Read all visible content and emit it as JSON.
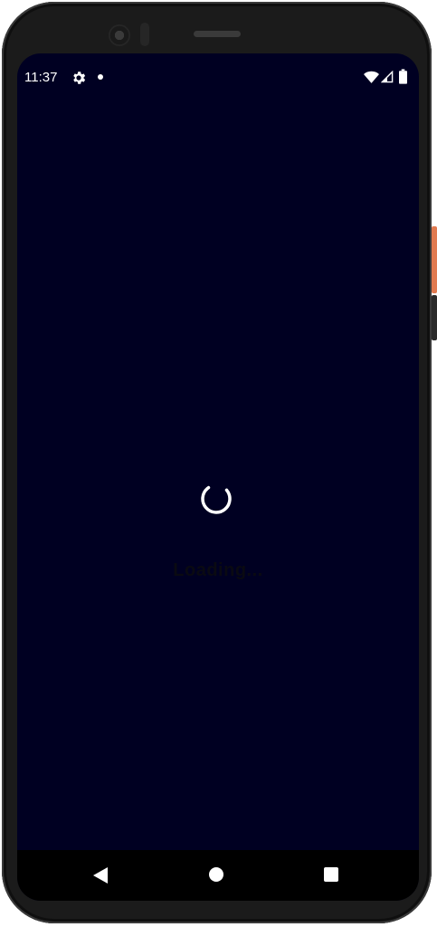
{
  "status_bar": {
    "time": "11:37",
    "icons": [
      "gear-icon",
      "dot-icon",
      "wifi-icon",
      "signal-icon",
      "battery-icon"
    ]
  },
  "main": {
    "loading_label": "Loading..."
  },
  "nav_bar": {
    "icons": [
      "back-icon",
      "home-icon",
      "recents-icon"
    ]
  },
  "colors": {
    "screen_background": "#000022",
    "status_foreground": "#ffffff",
    "spinner": "#ffffff",
    "loading_text": "#0a0a12",
    "nav_background": "#000000",
    "power_button": "#e07a50"
  }
}
